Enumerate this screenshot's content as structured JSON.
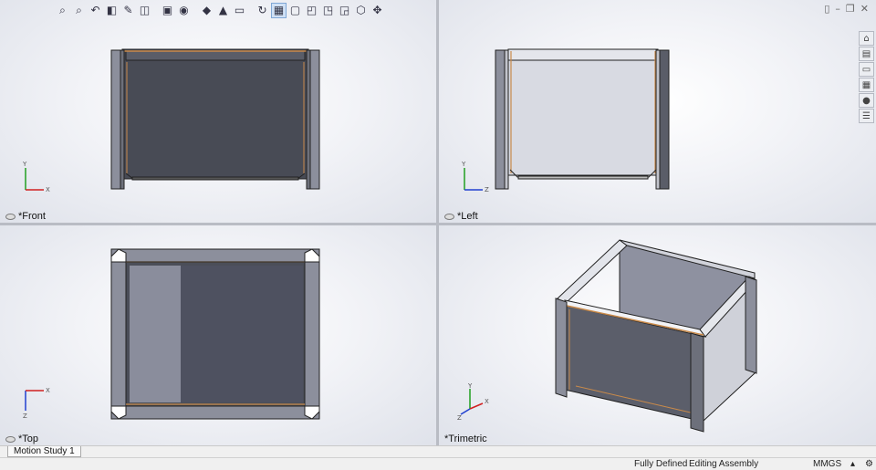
{
  "viewports": {
    "front": {
      "label": "*Front",
      "axis_h": "X",
      "axis_v": "Y"
    },
    "left": {
      "label": "*Left",
      "axis_h": "Z",
      "axis_v": "Y"
    },
    "top": {
      "label": "*Top",
      "axis_h": "X",
      "axis_v": "Z"
    },
    "trimetric": {
      "label": "*Trimetric",
      "axis_a": "Z",
      "axis_b": "X",
      "axis_c": "Y"
    }
  },
  "toolbar": {
    "icons": [
      "zoom-to-fit-icon",
      "zoom-area-icon",
      "previous-view-icon",
      "section-view-icon",
      "dynamic-annotation-icon",
      "view-orientation-icon",
      "display-style-icon",
      "hide-show-icon",
      "edit-appearance-icon",
      "apply-scene-icon",
      "view-settings-icon",
      "rotate-icon",
      "four-view-icon",
      "single-view-icon",
      "two-view-horizontal-icon",
      "two-view-vertical-icon",
      "link-views-icon",
      "3d-view-icon",
      "pan-icon"
    ]
  },
  "tabs": {
    "motion_study": "Motion Study 1"
  },
  "status": {
    "defined": "Fully Defined",
    "mode": "Editing Assembly",
    "units": "MMGS",
    "units_arrow": "▴"
  },
  "colors": {
    "viewport_bg": "#eef0f5",
    "panel_dark": "#4b4e58",
    "panel_light": "#d7d9e1",
    "post": "#8c8f9c",
    "edge_orange": "#c98a4a",
    "axis_x": "#d02020",
    "axis_y": "#20a020",
    "axis_z": "#2040d0"
  }
}
